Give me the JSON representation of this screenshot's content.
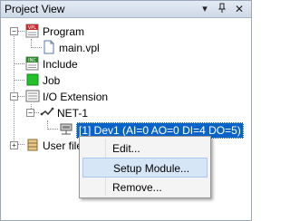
{
  "panel": {
    "title": "Project View"
  },
  "tree": {
    "program": {
      "label": "Program",
      "icon_text": "VPL"
    },
    "main_file": {
      "label": "main.vpl"
    },
    "include": {
      "label": "Include",
      "icon_text": "INC"
    },
    "job": {
      "label": "Job"
    },
    "io_extension": {
      "label": "I/O Extension"
    },
    "net1": {
      "label": "NET-1"
    },
    "dev1": {
      "label": "[1] Dev1 (AI=0 AO=0 DI=4 DO=5)"
    },
    "user_files": {
      "label": "User file"
    }
  },
  "context_menu": {
    "items": [
      {
        "label": "Edit..."
      },
      {
        "label": "Setup Module...",
        "highlighted": true
      },
      {
        "label": "Remove..."
      }
    ]
  },
  "colors": {
    "selection": "#0a64c8",
    "menu_hover": "#d7e6f7",
    "job_icon": "#22c02a"
  }
}
